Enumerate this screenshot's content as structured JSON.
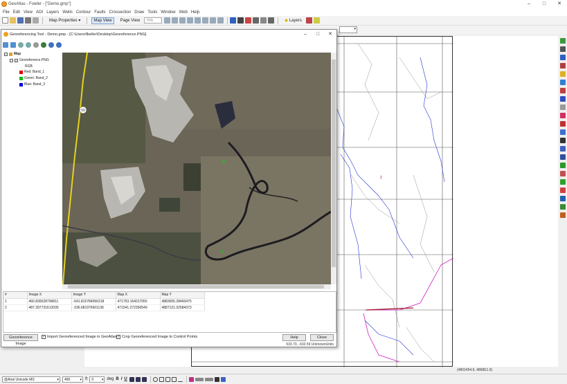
{
  "app": {
    "title": "GeoAtlas - Fowler - [\"Demo.gmp\"]",
    "window_controls": [
      "–",
      "□",
      "✕"
    ]
  },
  "menu": [
    "File",
    "Edit",
    "View",
    "AOI",
    "Layers",
    "Wells",
    "Contour",
    "Faults",
    "Crossection",
    "Draw",
    "Tools",
    "Window",
    "Web",
    "Help"
  ],
  "toolbar": {
    "map_properties": "Map Properties",
    "map_view": "Map View",
    "page_view": "Page View",
    "zoom": "75%",
    "layers": "Layers"
  },
  "statusbar": {
    "coords": "(4801454.9, 4868E1.6)"
  },
  "text_toolbar": {
    "font": "@Arial Unicode MS",
    "size": "490",
    "unit": "ft",
    "angle": "0",
    "angle_unit": "deg",
    "bold": "B",
    "italic": "I",
    "underline": "U"
  },
  "dialog": {
    "title": "Georeferencing Tool - Demo.gmp - [C:\\Users\\fbeller\\Desktop\\Georeference.PNG]",
    "window_controls": [
      "–",
      "□",
      "✕"
    ],
    "layer_tree": {
      "root": "Map",
      "layer": "Georeference.PNG",
      "mode": "RGB",
      "bands": [
        {
          "label": "Red:   Band_1",
          "color": "#e00000"
        },
        {
          "label": "Green: Band_2",
          "color": "#00c000"
        },
        {
          "label": "Blue:  Band_3",
          "color": "#0000e0"
        }
      ]
    },
    "highway_shield": "59",
    "gcp_table": {
      "columns": [
        "#",
        "Image X",
        "Image Y",
        "Map X",
        "Map Y"
      ],
      "rows": [
        [
          "1",
          "460.839528799811",
          "-541.815784066318",
          "471753.164017055",
          "4883005.28460475"
        ],
        [
          "2",
          "487.397731612035",
          "-336.681976601136",
          "471541.272350549",
          "4887121.02584373"
        ]
      ]
    },
    "georeference_button": "Georeference Image",
    "import_checkbox": "Import Georeferenced Image in GeoAtlas",
    "crop_checkbox": "Crop Georeferenced Image to Control Points",
    "help_button": "Help",
    "close_button": "Close",
    "status": "533.70, -632.59 UnknownUnits"
  }
}
